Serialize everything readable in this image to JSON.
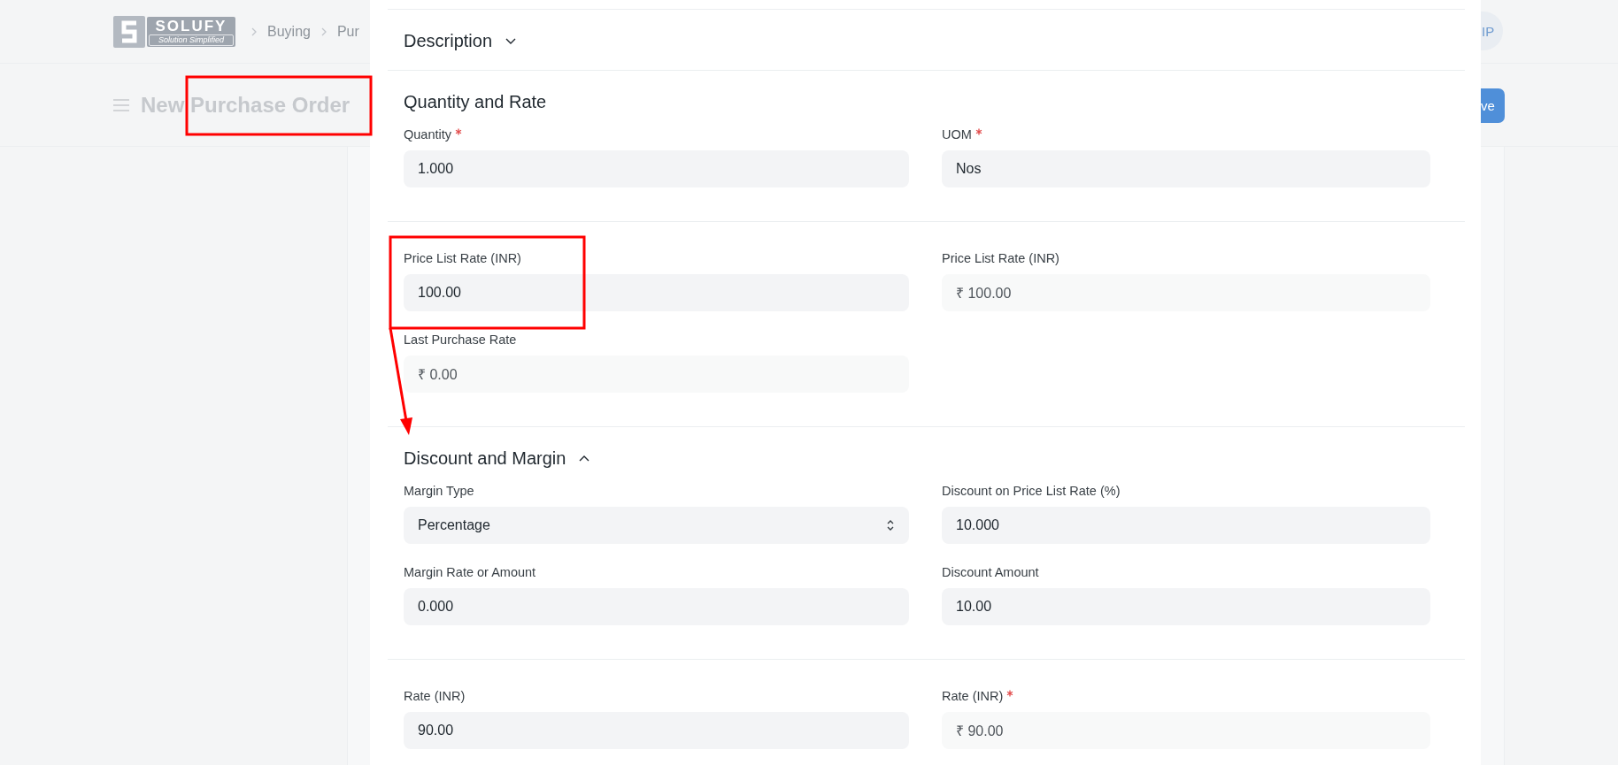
{
  "header": {
    "logo": {
      "name": "SOLUFY",
      "tagline": "Solution Simplified"
    },
    "breadcrumbs": [
      "Buying",
      "Pur"
    ],
    "avatar": "IP"
  },
  "page": {
    "title": "New Purchase Order",
    "save_button": "ve"
  },
  "dialog": {
    "sections": [
      {
        "title": "Description",
        "collapsible": true,
        "expanded": false
      },
      {
        "title": "Quantity and Rate",
        "collapsible": false,
        "columns": [
          [
            {
              "label": "Quantity",
              "required": true,
              "kind": "input",
              "value": "1.000"
            }
          ],
          [
            {
              "label": "UOM",
              "required": true,
              "kind": "input",
              "value": "Nos"
            }
          ]
        ]
      },
      {
        "columns": [
          [
            {
              "label": "Price List Rate (INR)",
              "required": false,
              "kind": "input",
              "value": "100.00"
            },
            {
              "label": "Last Purchase Rate",
              "required": false,
              "kind": "readonly",
              "value": "₹ 0.00"
            }
          ],
          [
            {
              "label": "Price List Rate (INR)",
              "required": false,
              "kind": "readonly",
              "value": "₹ 100.00"
            }
          ]
        ]
      },
      {
        "title": "Discount and Margin",
        "collapsible": true,
        "expanded": true,
        "columns": [
          [
            {
              "label": "Margin Type",
              "required": false,
              "kind": "select",
              "value": "Percentage"
            },
            {
              "label": "Margin Rate or Amount",
              "required": false,
              "kind": "input",
              "value": "0.000"
            }
          ],
          [
            {
              "label": "Discount on Price List Rate (%)",
              "required": false,
              "kind": "input",
              "value": "10.000"
            },
            {
              "label": "Discount Amount",
              "required": false,
              "kind": "input",
              "value": "10.00"
            }
          ]
        ]
      },
      {
        "columns": [
          [
            {
              "label": "Rate (INR)",
              "required": false,
              "kind": "input",
              "value": "90.00"
            }
          ],
          [
            {
              "label": "Rate (INR)",
              "required": true,
              "kind": "readonly",
              "value": "₹ 90.00"
            }
          ]
        ]
      }
    ]
  }
}
